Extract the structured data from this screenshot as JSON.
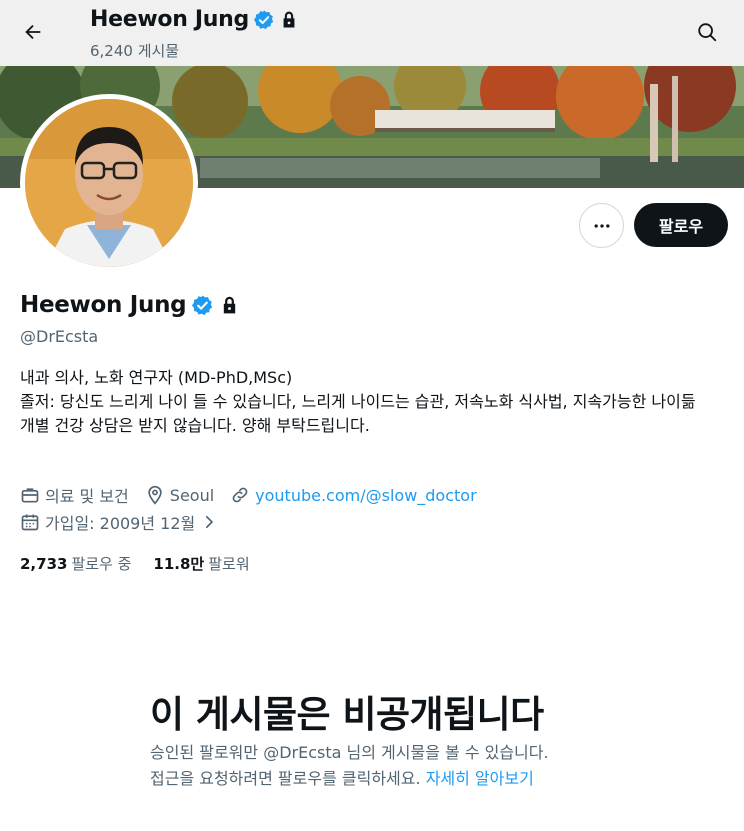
{
  "header": {
    "name": "Heewon Jung",
    "post_count": "6,240 게시물",
    "back_icon": "back-arrow-icon",
    "search_icon": "search-icon"
  },
  "profile": {
    "name": "Heewon Jung",
    "handle": "@DrEcsta",
    "verified_color": "#1d9bf0",
    "bio_lines": [
      "내과 의사, 노화 연구자 (MD-PhD,MSc)",
      "졸저: 당신도 느리게 나이 들 수 있습니다, 느리게 나이드는 습관, 저속노화 식사법, 지속가능한 나이듦",
      "개별 건강 상담은 받지 않습니다. 양해 부탁드립니다."
    ],
    "category": "의료 및 보건",
    "location": "Seoul",
    "website": "youtube.com/@slow_doctor",
    "joined": "가입일: 2009년 12월"
  },
  "actions": {
    "more_label": "•••",
    "follow_label": "팔로우"
  },
  "stats": {
    "following_count": "2,733",
    "following_label": "팔로우 중",
    "followers_count": "11.8만",
    "followers_label": "팔로워"
  },
  "private_notice": {
    "title": "이 게시물은 비공개됩니다",
    "line1": "승인된 팔로워만 @DrEcsta 님의 게시물을 볼 수 있습니다.",
    "line2": "접근을 요청하려면 팔로우를 클릭하세요.",
    "learn_more": "자세히 알아보기"
  },
  "colors": {
    "accent": "#1d9bf0",
    "text_primary": "#0f1419",
    "text_secondary": "#536471",
    "button_dark": "#0f1419"
  }
}
